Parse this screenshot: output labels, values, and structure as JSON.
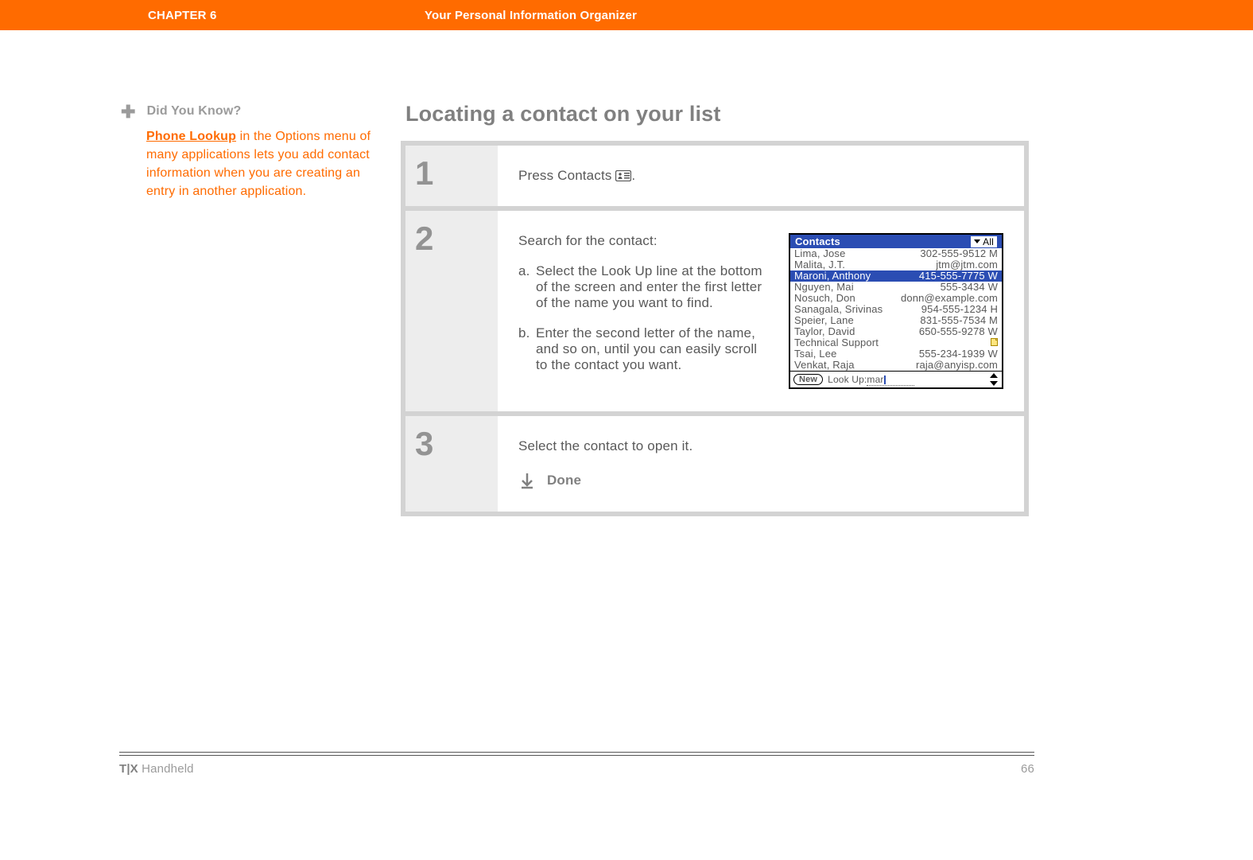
{
  "header": {
    "chapter": "CHAPTER 6",
    "title": "Your Personal Information Organizer"
  },
  "sidebar": {
    "heading": "Did You Know?",
    "link_text": "Phone Lookup",
    "body_rest": " in the Options menu of many applications lets you add contact information when you are creating an entry in another application."
  },
  "page_title": "Locating a contact on your list",
  "steps": [
    {
      "num": "1",
      "text_before_icon": "Press Contacts ",
      "text_after_icon": "."
    },
    {
      "num": "2",
      "lead": "Search for the contact:",
      "subs": [
        {
          "letter": "a.",
          "text": "Select the Look Up line at the bottom of the screen and enter the first letter of the name you want to find."
        },
        {
          "letter": "b.",
          "text": "Enter the second letter of the name, and so on, until you can easily scroll to the contact you want."
        }
      ]
    },
    {
      "num": "3",
      "text": "Select the contact to open it.",
      "done": "Done"
    }
  ],
  "palm": {
    "title": "Contacts",
    "category": "All",
    "rows": [
      {
        "name": "Lima, Jose",
        "phone": "302-555-9512 M",
        "sel": false
      },
      {
        "name": "Malita, J.T.",
        "phone": "jtm@jtm.com",
        "sel": false
      },
      {
        "name": "Maroni, Anthony",
        "phone": "415-555-7775 W",
        "sel": true
      },
      {
        "name": "Nguyen, Mai",
        "phone": "555-3434 W",
        "sel": false
      },
      {
        "name": "Nosuch, Don",
        "phone": "donn@example.com",
        "sel": false
      },
      {
        "name": "Sanagala, Srivinas",
        "phone": "954-555-1234 H",
        "sel": false
      },
      {
        "name": "Speier, Lane",
        "phone": "831-555-7534 M",
        "sel": false
      },
      {
        "name": "Taylor, David",
        "phone": "650-555-9278 W",
        "sel": false
      },
      {
        "name": "Technical Support",
        "phone": "",
        "sel": false,
        "note": true
      },
      {
        "name": "Tsai, Lee",
        "phone": "555-234-1939 W",
        "sel": false
      },
      {
        "name": "Venkat, Raja",
        "phone": "raja@anyisp.com",
        "sel": false
      }
    ],
    "new_label": "New",
    "lookup_label": "Look Up:",
    "lookup_value": "mar"
  },
  "footer": {
    "model_bold": "T|X",
    "model_rest": " Handheld",
    "page_no": "66"
  }
}
